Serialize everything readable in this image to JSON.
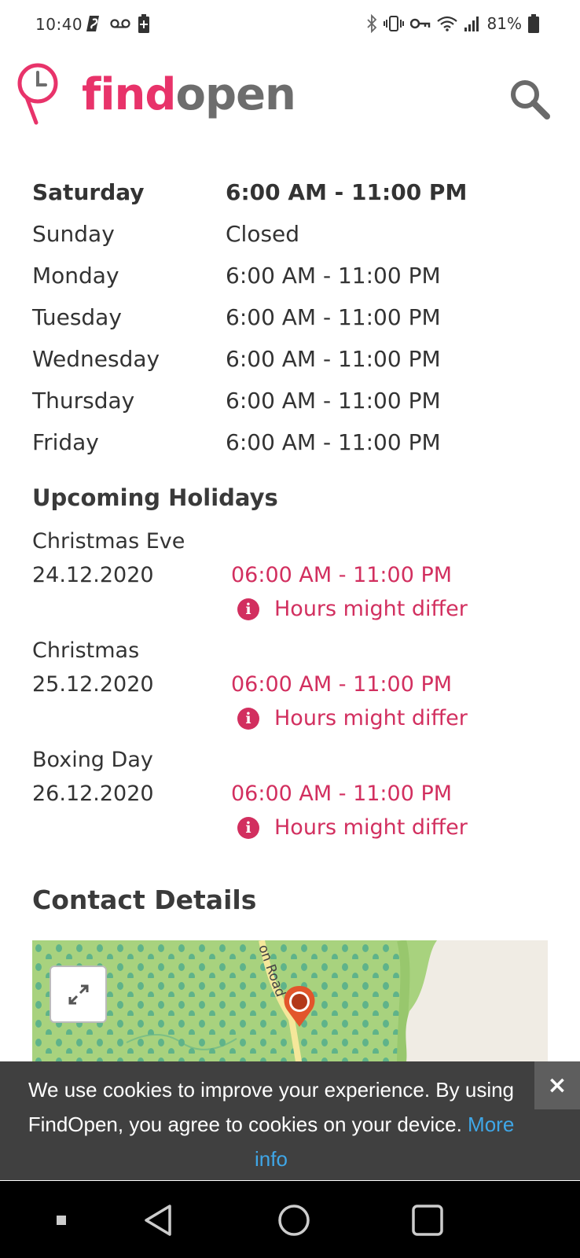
{
  "status_bar": {
    "time": "10:40",
    "battery": "81%",
    "left_icons": [
      "s-app-icon",
      "voicemail-icon",
      "battery-saver-icon"
    ],
    "right_icons": [
      "bluetooth-icon",
      "vibrate-icon",
      "vpn-key-icon",
      "wifi-icon",
      "signal-icon",
      "battery-icon"
    ]
  },
  "header": {
    "logo_find": "find",
    "logo_open": "open",
    "brand_color": "#e8336a"
  },
  "hours": [
    {
      "day": "Saturday",
      "time": "6:00 AM - 11:00 PM",
      "today": true
    },
    {
      "day": "Sunday",
      "time": "Closed",
      "today": false
    },
    {
      "day": "Monday",
      "time": "6:00 AM - 11:00 PM",
      "today": false
    },
    {
      "day": "Tuesday",
      "time": "6:00 AM - 11:00 PM",
      "today": false
    },
    {
      "day": "Wednesday",
      "time": "6:00 AM - 11:00 PM",
      "today": false
    },
    {
      "day": "Thursday",
      "time": "6:00 AM - 11:00 PM",
      "today": false
    },
    {
      "day": "Friday",
      "time": "6:00 AM - 11:00 PM",
      "today": false
    }
  ],
  "holidays_title": "Upcoming Holidays",
  "holidays": [
    {
      "name": "Christmas Eve",
      "date": "24.12.2020",
      "time": "06:00 AM - 11:00 PM",
      "note": "Hours might differ"
    },
    {
      "name": "Christmas",
      "date": "25.12.2020",
      "time": "06:00 AM - 11:00 PM",
      "note": "Hours might differ"
    },
    {
      "name": "Boxing Day",
      "date": "26.12.2020",
      "time": "06:00 AM - 11:00 PM",
      "note": "Hours might differ"
    }
  ],
  "contact_title": "Contact Details",
  "map": {
    "road_label": "on Road"
  },
  "cookie": {
    "text": "We use cookies to improve your experience. By using FindOpen, you agree to cookies on your device.",
    "link": "More info",
    "close": "×"
  },
  "accent_color": "#d22f5f"
}
